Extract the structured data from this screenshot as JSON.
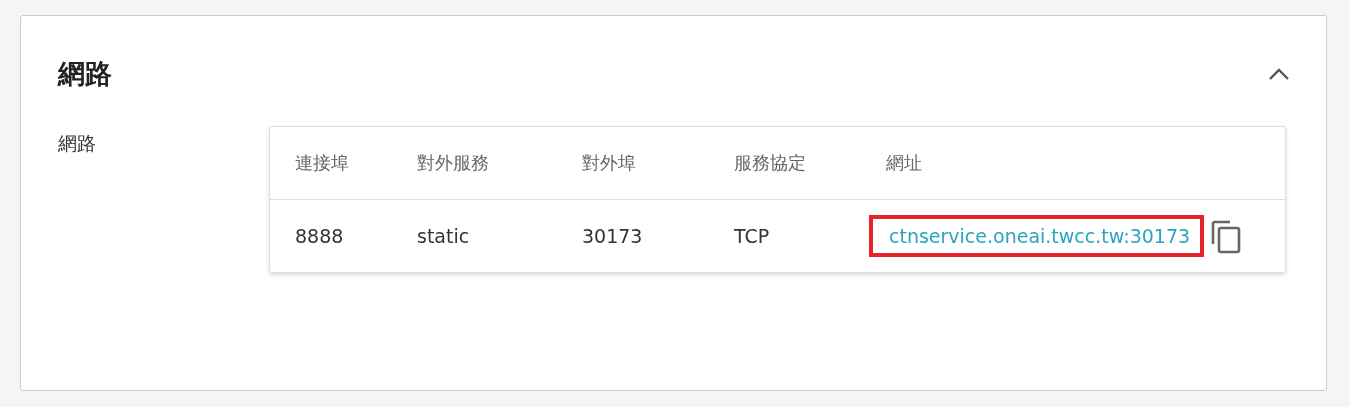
{
  "section": {
    "title": "網路",
    "expanded": true
  },
  "field": {
    "label": "網路"
  },
  "table": {
    "columns": [
      "連接埠",
      "對外服務",
      "對外埠",
      "服務協定",
      "網址"
    ],
    "rows": [
      {
        "cells": [
          "8888",
          "static",
          "30173",
          "TCP"
        ],
        "url": "ctnservice.oneai.twcc.tw:30173",
        "highlighted": true
      }
    ]
  }
}
